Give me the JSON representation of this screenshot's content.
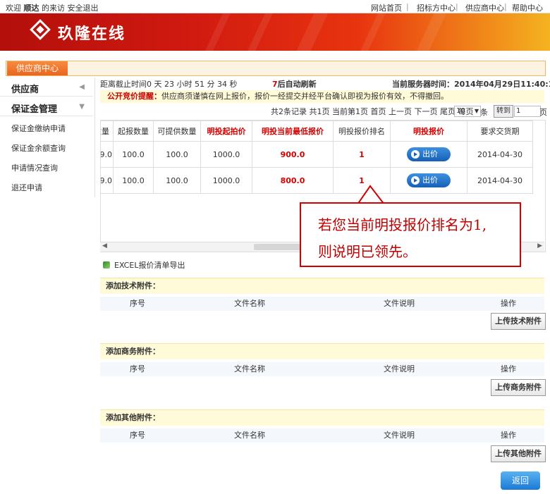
{
  "topbar": {
    "welcome": "欢迎",
    "user": "顺达",
    "visit": "的来访",
    "logout": "安全退出",
    "nav": [
      "网站首页",
      "招标方中心",
      "供应商中心",
      "帮助中心"
    ],
    "sep": "|"
  },
  "brand": {
    "name": "玖隆在线"
  },
  "center_tab": "供应商中心",
  "sidebar": {
    "group1": "供应商",
    "group2": "保证金管理",
    "items": [
      "保证金缴纳申请",
      "保证金余额查询",
      "申请情况查询",
      "退还申请"
    ]
  },
  "info": {
    "countdown": "距离截止时间0 天  23 小时  51 分  34 秒",
    "refresh_num": "7",
    "refresh_text": "后自动刷新",
    "server_time": "当前服务器时间：2014年04月29日11:40:10"
  },
  "notice": {
    "title": "公开竞价提醒：",
    "text": "供应商须谨慎在网上报价，报价一经提交并经平台确认即视为报价有效，不得撤回。"
  },
  "pager": {
    "text": "共2条记录 共1页  当前第1页  首页  上一页  下一页  尾页  每页",
    "page_size": "10",
    "unit": "条",
    "goto": "转到",
    "goto_value": "1",
    "page_unit": "页"
  },
  "table": {
    "headers": [
      "数量",
      "起报数量",
      "可提供数量",
      "明投起拍价",
      "明投当前最低报价",
      "明投报价排名",
      "明投报价",
      "要求交货期"
    ],
    "rows": [
      [
        "9.0",
        "100.0",
        "100.0",
        "1000.0",
        "900.0",
        "1",
        "出价",
        "2014-04-30"
      ],
      [
        "9.0",
        "100.0",
        "100.0",
        "1000.0",
        "800.0",
        "1",
        "出价",
        "2014-04-30"
      ]
    ]
  },
  "callout": {
    "line1": "若您当前明投报价排名为1,",
    "line2": "则说明已领先。"
  },
  "excel": "EXCEL报价清单导出",
  "sections": [
    {
      "title": "添加技术附件：",
      "button": "上传技术附件"
    },
    {
      "title": "添加商务附件：",
      "button": "上传商务附件"
    },
    {
      "title": "添加其他附件：",
      "button": "上传其他附件"
    }
  ],
  "attach_cols": [
    "序号",
    "文件名称",
    "文件说明",
    "操作"
  ],
  "back": "返回"
}
